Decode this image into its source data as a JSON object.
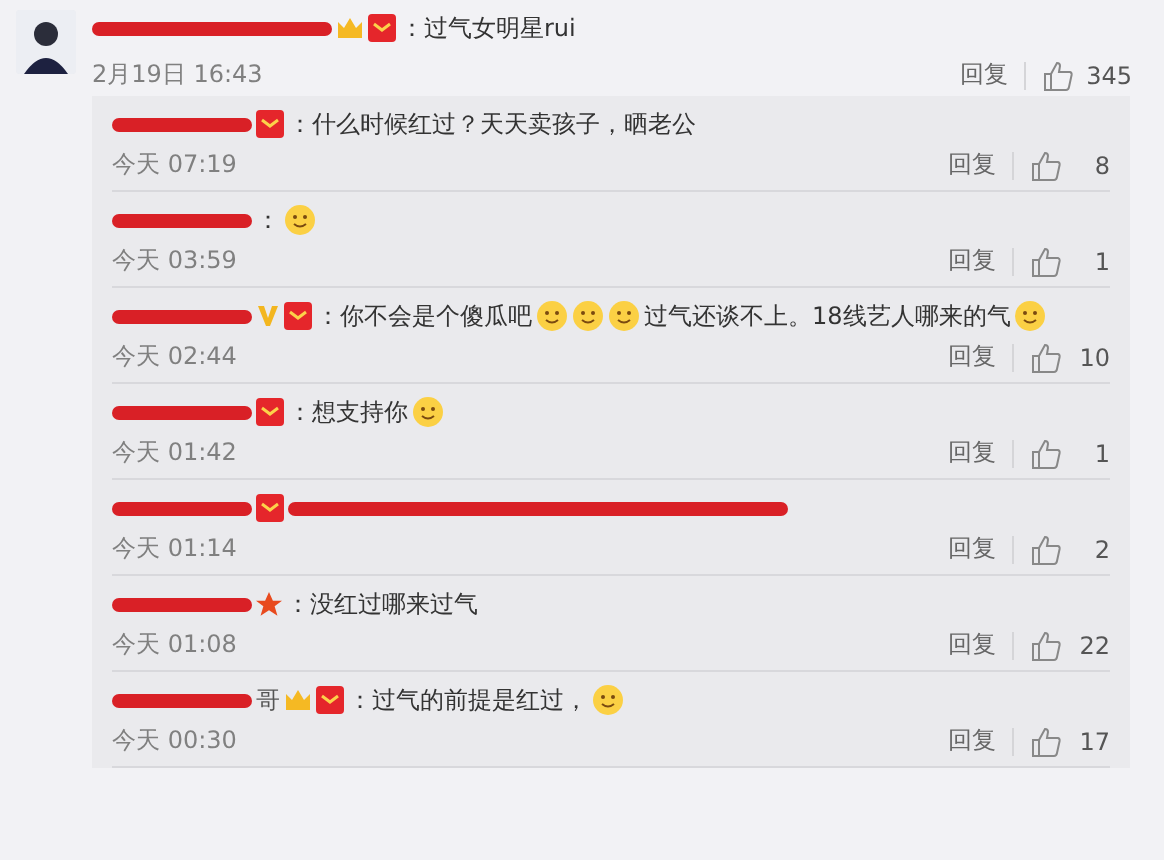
{
  "comment": {
    "badges": [
      {
        "kind": "crown"
      },
      {
        "kind": "vip"
      }
    ],
    "content": [
      {
        "kind": "text",
        "text": "：过气女明星rui"
      }
    ],
    "time": "2月19日 16:43",
    "reply": "回复",
    "likes": "345"
  },
  "replies": [
    {
      "badges": [
        {
          "kind": "vip"
        }
      ],
      "content": [
        {
          "kind": "text",
          "text": "：什么时候红过？天天卖孩子，晒老公"
        }
      ],
      "time": "今天 07:19",
      "reply": "回复",
      "likes": "8"
    },
    {
      "content": [
        {
          "kind": "text",
          "text": "："
        },
        {
          "kind": "emoji"
        }
      ],
      "time": "今天 03:59",
      "reply": "回复",
      "likes": "1"
    },
    {
      "badges": [
        {
          "kind": "v"
        },
        {
          "kind": "vip"
        }
      ],
      "content": [
        {
          "kind": "text",
          "text": "：你不会是个傻瓜吧"
        },
        {
          "kind": "emoji"
        },
        {
          "kind": "emoji"
        },
        {
          "kind": "emoji"
        },
        {
          "kind": "text",
          "text": "过气还谈不上。18线艺人哪来的气"
        },
        {
          "kind": "emoji"
        }
      ],
      "time": "今天 02:44",
      "reply": "回复",
      "likes": "10"
    },
    {
      "badges": [
        {
          "kind": "vip"
        }
      ],
      "content": [
        {
          "kind": "text",
          "text": "：想支持你"
        },
        {
          "kind": "emoji"
        }
      ],
      "time": "今天 01:42",
      "reply": "回复",
      "likes": "1"
    },
    {
      "badges": [
        {
          "kind": "vip"
        }
      ],
      "content": [
        {
          "kind": "redacted"
        }
      ],
      "time": "今天 01:14",
      "reply": "回复",
      "likes": "2"
    },
    {
      "badges": [
        {
          "kind": "star"
        }
      ],
      "content": [
        {
          "kind": "text",
          "text": "：没红过哪来过气"
        }
      ],
      "time": "今天 01:08",
      "reply": "回复",
      "likes": "22"
    },
    {
      "name_tail": "哥",
      "badges": [
        {
          "kind": "crown"
        },
        {
          "kind": "vip"
        }
      ],
      "content": [
        {
          "kind": "text",
          "text": "：过气的前提是红过，"
        },
        {
          "kind": "emoji"
        }
      ],
      "time": "今天 00:30",
      "reply": "回复",
      "likes": "17"
    }
  ]
}
